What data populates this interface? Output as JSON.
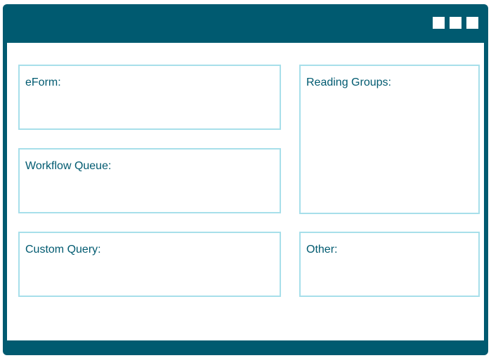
{
  "colors": {
    "frame": "#005a70",
    "panel_border": "#a7dfea",
    "label_text": "#005a70",
    "background": "#ffffff"
  },
  "title_bar": {
    "window_controls": [
      "square-button-icon",
      "square-button-icon",
      "square-button-icon"
    ]
  },
  "panels": {
    "eform": {
      "label": "eForm:"
    },
    "workflow_queue": {
      "label": "Workflow Queue:"
    },
    "custom_query": {
      "label": "Custom Query:"
    },
    "reading_groups": {
      "label": "Reading Groups:"
    },
    "other": {
      "label": "Other:"
    }
  }
}
